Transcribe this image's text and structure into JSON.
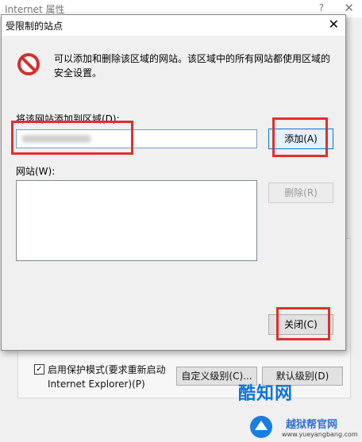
{
  "background_window": {
    "title": "Internet 属性",
    "help": "?",
    "close": "✕",
    "checkbox_label": "启用保护模式(要求重新启动 Internet Explorer)(P)",
    "custom_level_button": "自定义级别(C)...",
    "default_level_button": "默认级别(D)"
  },
  "dialog": {
    "title": "受限制的站点",
    "close": "✕",
    "description": "可以添加和删除该区域的网站。该区域中的所有网站都使用区域的安全设置。",
    "add_site_label": "将该网站添加到区域(D):",
    "add_site_value": "",
    "add_button": "添加(A)",
    "websites_label": "网站(W):",
    "websites": [],
    "remove_button": "删除(R)",
    "close_button": "关闭(C)"
  },
  "watermark": {
    "brand": "酷知网",
    "site_name": "越狱帮官网",
    "url": "www.yueyangbang.com"
  },
  "colors": {
    "highlight": "#e0302c",
    "watermark_blue": "#0e74d8"
  }
}
